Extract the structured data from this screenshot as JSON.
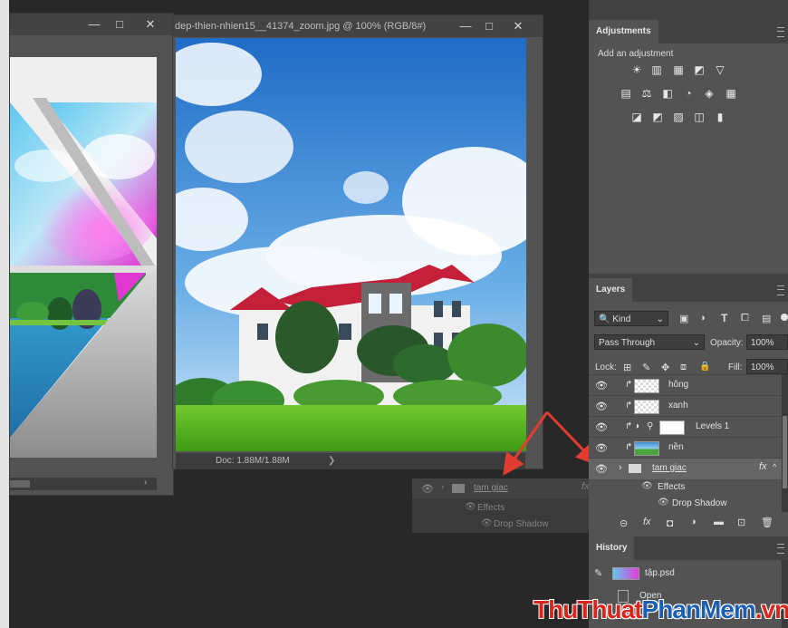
{
  "left_window": {
    "buttons": [
      "—",
      "□",
      "✕"
    ]
  },
  "doc_window": {
    "title": "dep-thien-nhien15__41374_zoom.jpg @ 100% (RGB/8#)",
    "buttons": [
      "—",
      "□",
      "✕"
    ],
    "status": "Doc: 1.88M/1.88M",
    "status_arrow": "❯"
  },
  "floating_drag": {
    "layer_name": "tam giac",
    "fx": "fx",
    "effects": "Effects",
    "drop_shadow": "Drop Shadow"
  },
  "adjustments": {
    "tab": "Adjustments",
    "hint": "Add an adjustment",
    "row1": [
      "☀",
      "▥",
      "▦",
      "◩",
      "▽"
    ],
    "row2": [
      "▤",
      "⚖",
      "◧",
      "◔",
      "◈",
      "▦"
    ],
    "row3": [
      "◪",
      "◩",
      "▨",
      "◫",
      "▮"
    ]
  },
  "layers": {
    "tab": "Layers",
    "filter_label": "Kind",
    "filter_icons": [
      "▣",
      "◑",
      "T",
      "⧠",
      "▤"
    ],
    "blend_mode": "Pass Through",
    "opacity_label": "Opacity:",
    "opacity_value": "100%",
    "lock_label": "Lock:",
    "lock_icons": [
      "⊞",
      "✎",
      "✥",
      "⧈",
      "🔒"
    ],
    "fill_label": "Fill:",
    "fill_value": "100%",
    "rows": [
      {
        "name": "hông"
      },
      {
        "name": "xanh"
      },
      {
        "name": "Levels 1"
      },
      {
        "name": "nền"
      },
      {
        "name": "tam giac"
      }
    ],
    "effects": "Effects",
    "drop_shadow": "Drop Shadow",
    "fx": "fx",
    "bottom_icons": [
      "⊝",
      "fx",
      "◘",
      "◑",
      "▬",
      "⊡",
      "🗑"
    ]
  },
  "history": {
    "tab": "History",
    "snapshot_name": "tập.psd",
    "item": "Open"
  },
  "watermark": {
    "part1": "ThuThuat",
    "part2": "PhanMem",
    "part3": ".vn"
  },
  "colors": {
    "accent_arrow": "#e23b30",
    "panel_bg": "#535353",
    "workspace_bg": "#282828",
    "watermark_red": "#d9261c",
    "watermark_blue": "#1a5fb4"
  }
}
